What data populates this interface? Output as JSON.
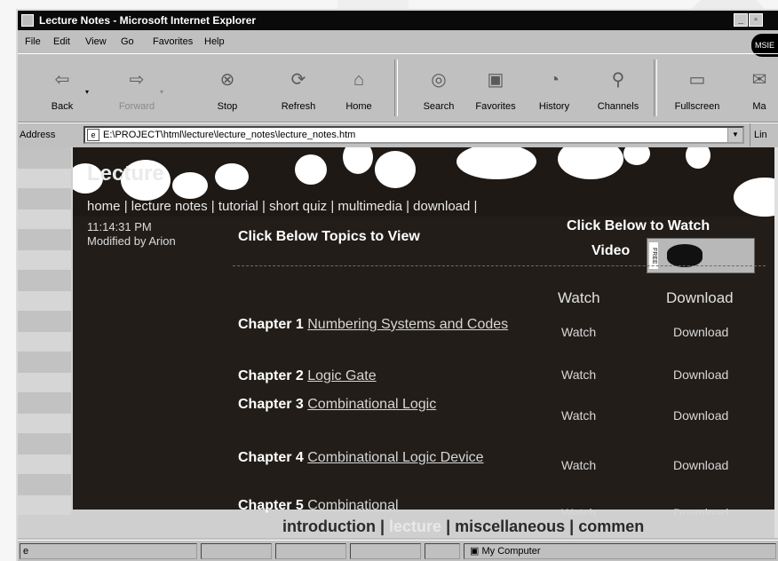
{
  "window": {
    "title": "Lecture Notes - Microsoft Internet Explorer"
  },
  "menu": [
    "File",
    "Edit",
    "View",
    "Go",
    "Favorites",
    "Help"
  ],
  "menu_logo": "MSIE",
  "toolbar": {
    "back": "Back",
    "forward": "Forward",
    "stop": "Stop",
    "refresh": "Refresh",
    "home": "Home",
    "search": "Search",
    "favorites": "Favorites",
    "history": "History",
    "channels": "Channels",
    "fullscreen": "Fullscreen",
    "mail": "Ma"
  },
  "address": {
    "label": "Address",
    "value": "E:\\PROJECT\\html\\lecture\\lecture_notes\\lecture_notes.htm",
    "links": "Lin"
  },
  "page": {
    "banner_title": "Lecture",
    "nav_line": "home | lecture notes | tutorial | short quiz | multimedia | download |",
    "time": "11:14:31 PM",
    "modified": "Modified by Arion",
    "topics_heading": "Click Below Topics to View",
    "video_heading_l1": "Click Below to Watch",
    "video_heading_l2": "Video",
    "badge_text": "FREE",
    "col_watch": "Watch",
    "col_download": "Download",
    "chapters": [
      {
        "num": "Chapter 1",
        "title": "Numbering Systems and Codes",
        "watch": "Watch",
        "download": "Download"
      },
      {
        "num": "Chapter 2",
        "title": "Logic Gate",
        "watch": "Watch",
        "download": "Download"
      },
      {
        "num": "Chapter 3",
        "title": "Combinational Logic",
        "watch": "Watch",
        "download": "Download"
      },
      {
        "num": "Chapter 4",
        "title": "Combinational Logic Device",
        "watch": "Watch",
        "download": "Download"
      },
      {
        "num": "Chapter 5",
        "title": "Combinational",
        "watch": "Watch",
        "download": "Download"
      }
    ],
    "bottom_nav": {
      "introduction": "introduction",
      "sep1": " | ",
      "lecture": "lecture",
      "sep2": " | ",
      "miscellaneous": "miscellaneous",
      "sep3": " | ",
      "comments": "commen"
    }
  },
  "status": {
    "zone": "My Computer"
  }
}
